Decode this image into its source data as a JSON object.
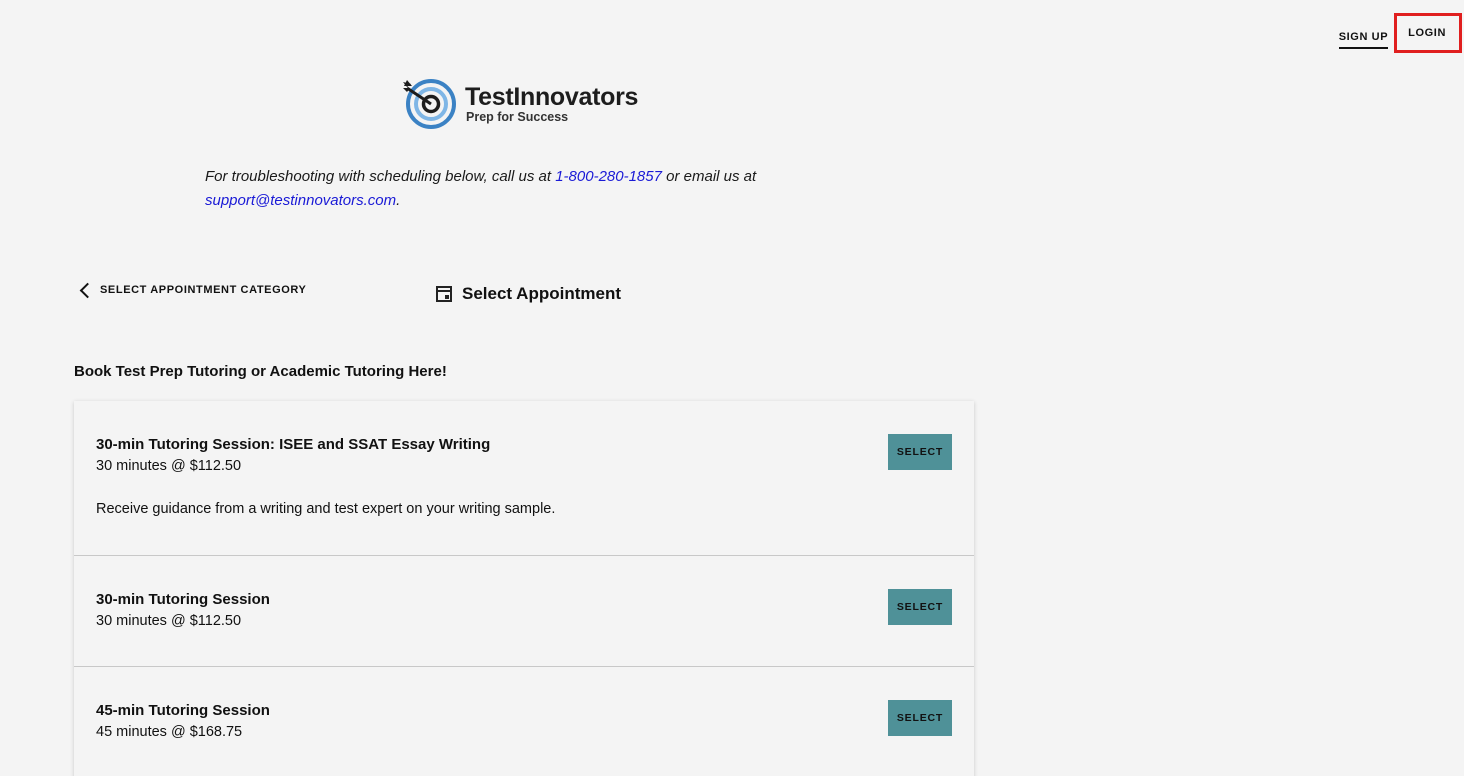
{
  "nav": {
    "signup_label": "SIGN UP",
    "login_label": "LOGIN"
  },
  "brand": {
    "name": "TestInnovators",
    "tagline": "Prep for Success",
    "logo_icon": "target-arrow-icon",
    "colors": {
      "ring_outer": "#3b82c4",
      "ring_inner": "#7fb6e6",
      "accent_button": "#4f9198",
      "link": "#1a1ad6",
      "highlight_box": "#e01f1f"
    }
  },
  "notice": {
    "prefix": "For troubleshooting with scheduling below, call us at ",
    "phone": "1-800-280-1857",
    "middle": " or email us at ",
    "email": "support@testinnovators.com",
    "suffix": "."
  },
  "navigation": {
    "back_label": "SELECT APPOINTMENT CATEGORY",
    "section_title": "Select Appointment",
    "section_icon": "calendar-icon"
  },
  "book_heading": "Book Test Prep Tutoring or Academic Tutoring Here!",
  "appointments": [
    {
      "title": "30-min Tutoring Session: ISEE and SSAT Essay Writing",
      "price": "30 minutes @ $112.50",
      "description": "Receive guidance from a writing and test expert on your writing sample.",
      "button_label": "SELECT"
    },
    {
      "title": "30-min Tutoring Session",
      "price": "30 minutes @ $112.50",
      "button_label": "SELECT"
    },
    {
      "title": "45-min Tutoring Session",
      "price": "45 minutes @ $168.75",
      "button_label": "SELECT"
    }
  ]
}
